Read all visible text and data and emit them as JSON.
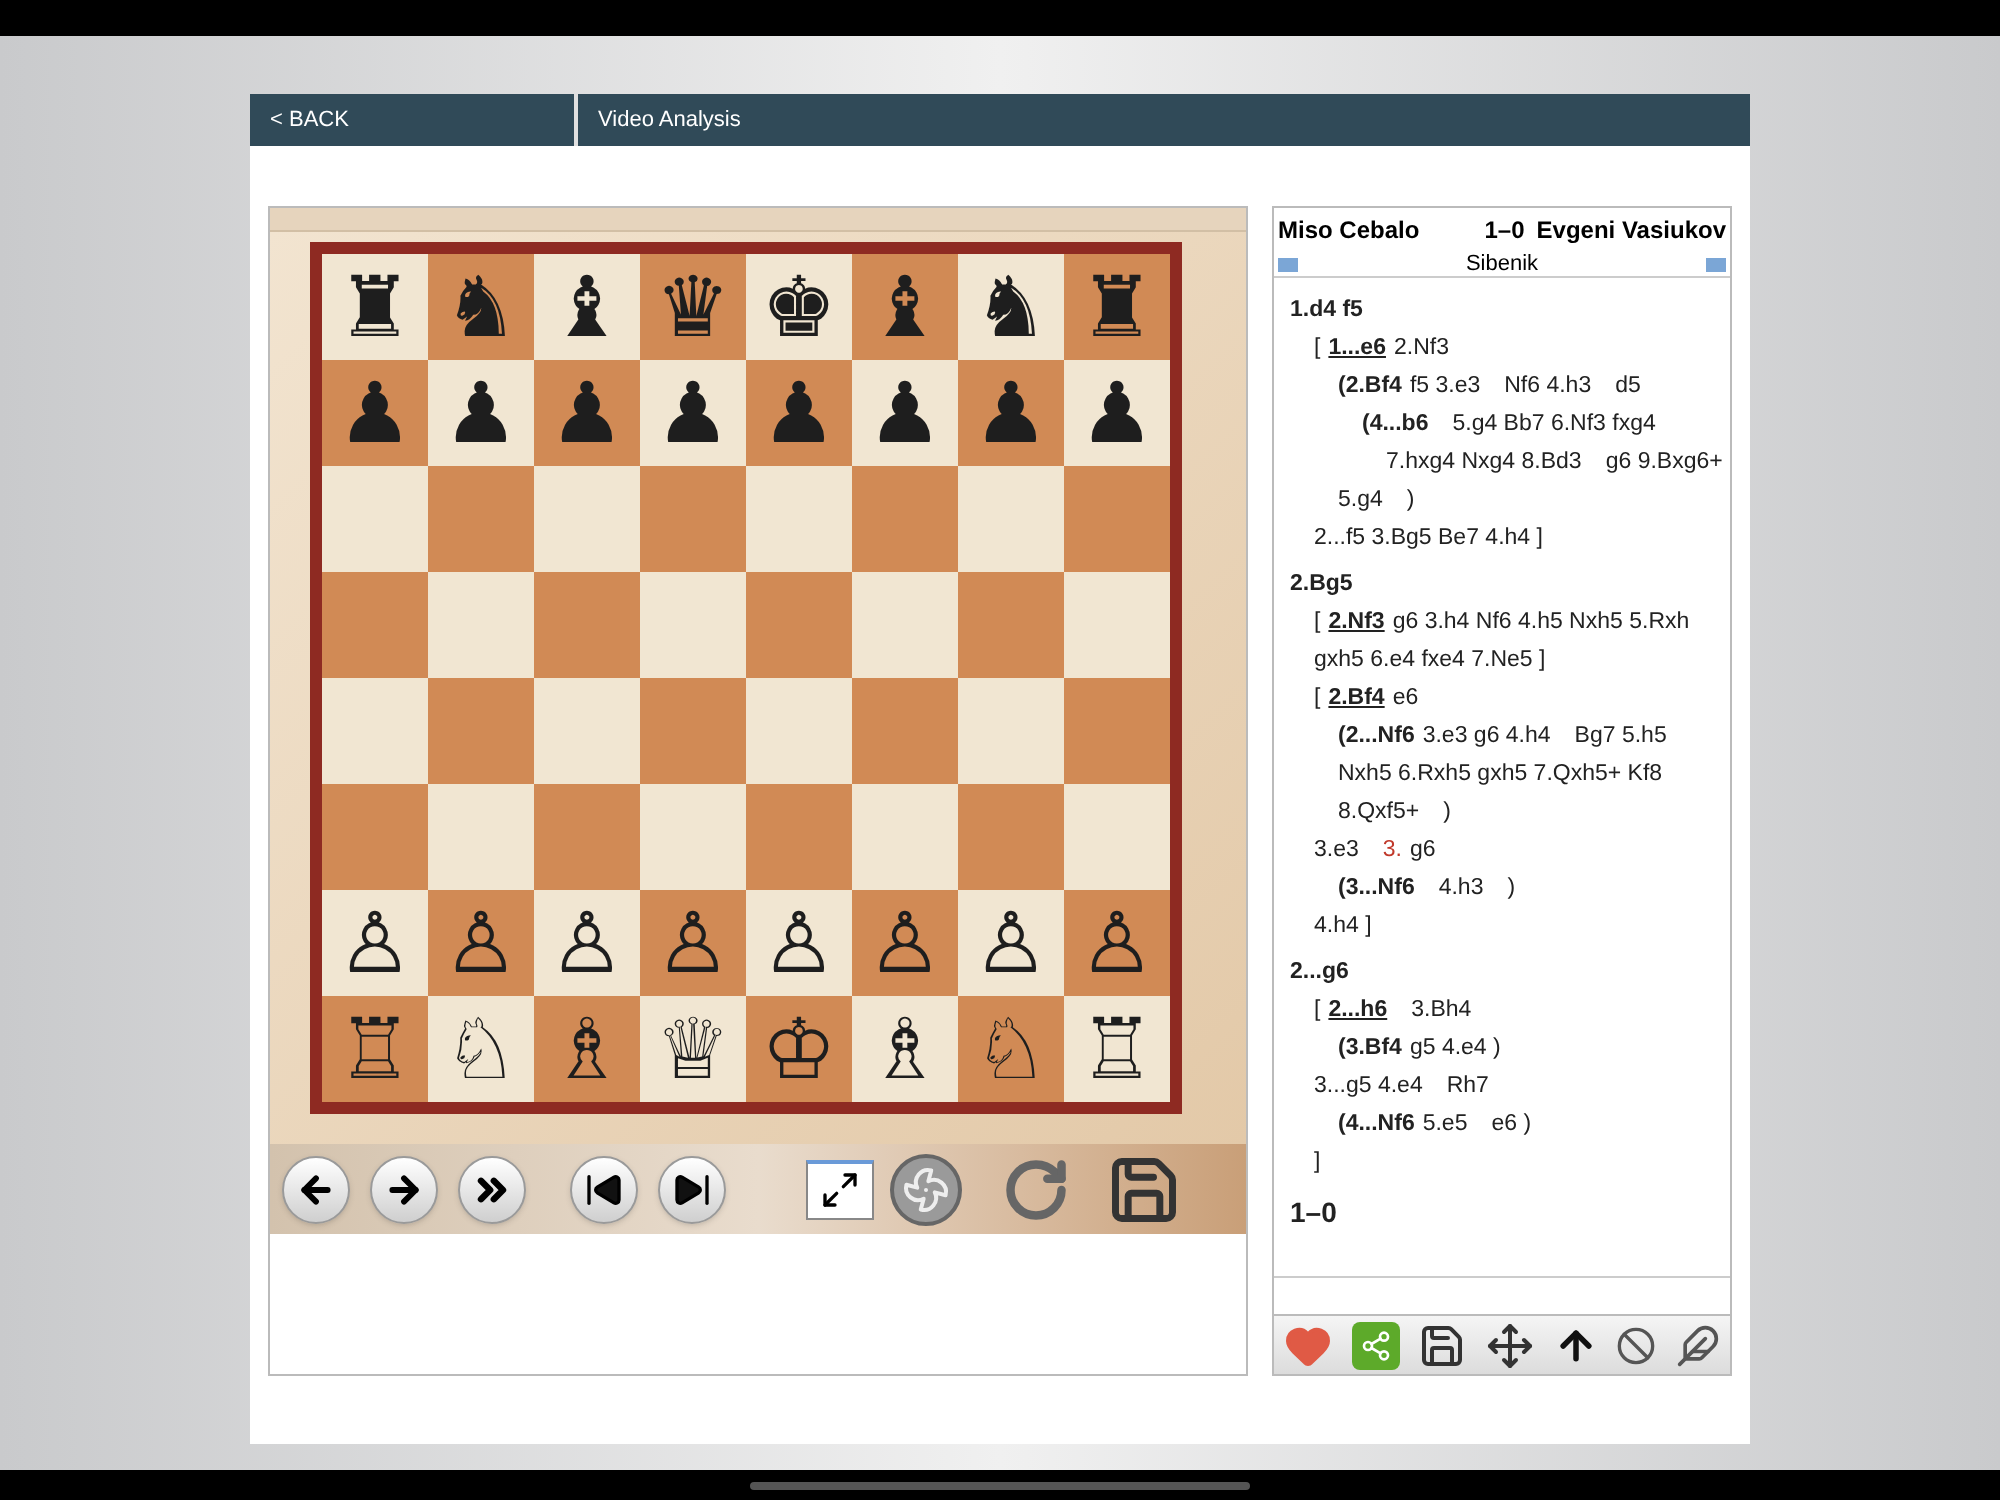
{
  "header": {
    "back": "< BACK",
    "title": "Video Analysis"
  },
  "board": {
    "ranks": [
      {
        "kind": "pieces",
        "squares": [
          "♜",
          "♞",
          "♝",
          "♛",
          "♚",
          "♝",
          "♞",
          "♜"
        ]
      },
      {
        "kind": "pieces",
        "squares": [
          "♟",
          "♟",
          "♟",
          "♟",
          "♟",
          "♟",
          "♟",
          "♟"
        ]
      },
      {
        "kind": "empty"
      },
      {
        "kind": "empty"
      },
      {
        "kind": "empty"
      },
      {
        "kind": "empty"
      },
      {
        "kind": "pieces",
        "squares": [
          "♙",
          "♙",
          "♙",
          "♙",
          "♙",
          "♙",
          "♙",
          "♙"
        ]
      },
      {
        "kind": "pieces",
        "squares": [
          "♖",
          "♘",
          "♗",
          "♕",
          "♔",
          "♗",
          "♘",
          "♖"
        ]
      }
    ]
  },
  "notation": {
    "white_player": "Miso Cebalo",
    "result": "1–0",
    "black_player": "Evgeni Vasiukov",
    "event": "Sibenik",
    "lines": [
      {
        "segments": [
          {
            "text": "1.d4 f5",
            "kind": "bold"
          }
        ],
        "children": [
          {
            "segments": [
              {
                "text": "[",
                "kind": "plain"
              },
              {
                "text": "1...e6",
                "kind": "key"
              },
              {
                "text": "2.Nf3",
                "kind": "plain"
              }
            ],
            "children": [
              {
                "segments": [
                  {
                    "text": "(2.Bf4",
                    "kind": "bold"
                  },
                  {
                    "text": "f5 3.e3",
                    "kind": "plain"
                  },
                  {
                    "text": "Nf6 4.h3",
                    "kind": "gap"
                  },
                  {
                    "text": "d5",
                    "kind": "gap"
                  }
                ],
                "children": [
                  {
                    "segments": [
                      {
                        "text": "(4...b6",
                        "kind": "bold"
                      },
                      {
                        "text": "5.g4 Bb7 6.Nf3 fxg4",
                        "kind": "gap"
                      }
                    ],
                    "children": [
                      {
                        "segments": [
                          {
                            "text": "7.hxg4 Nxg4 8.Bd3",
                            "kind": "plain"
                          },
                          {
                            "text": "g6 9.Bxg6+",
                            "kind": "gap"
                          }
                        ]
                      }
                    ]
                  }
                ]
              },
              {
                "segments": [
                  {
                    "text": "5.g4",
                    "kind": "plain"
                  },
                  {
                    "text": ")",
                    "kind": "gap"
                  }
                ]
              }
            ]
          },
          {
            "segments": [
              {
                "text": "2...f5 3.Bg5 Be7 4.h4 ]",
                "kind": "plain"
              }
            ]
          }
        ]
      },
      {
        "segments": [
          {
            "text": "2.Bg5",
            "kind": "bold"
          }
        ],
        "children": [
          {
            "segments": [
              {
                "text": "[",
                "kind": "plain"
              },
              {
                "text": "2.Nf3",
                "kind": "key"
              },
              {
                "text": "g6 3.h4 Nf6 4.h5 Nxh5 5.Rxh",
                "kind": "plain"
              }
            ]
          },
          {
            "segments": [
              {
                "text": "gxh5 6.e4 fxe4 7.Ne5 ]",
                "kind": "plain"
              }
            ]
          },
          {
            "segments": [
              {
                "text": "[",
                "kind": "plain"
              },
              {
                "text": "2.Bf4",
                "kind": "key"
              },
              {
                "text": "e6",
                "kind": "plain"
              }
            ],
            "children": [
              {
                "segments": [
                  {
                    "text": "(2...Nf6",
                    "kind": "bold"
                  },
                  {
                    "text": "3.e3 g6 4.h4",
                    "kind": "plain"
                  },
                  {
                    "text": "Bg7 5.h5",
                    "kind": "gap"
                  }
                ]
              },
              {
                "segments": [
                  {
                    "text": "Nxh5 6.Rxh5 gxh5 7.Qxh5+ Kf8",
                    "kind": "plain"
                  }
                ]
              },
              {
                "segments": [
                  {
                    "text": "8.Qxf5+",
                    "kind": "plain"
                  },
                  {
                    "text": ")",
                    "kind": "gap"
                  }
                ]
              }
            ]
          },
          {
            "segments": [
              {
                "text": "3.e3",
                "kind": "plain"
              },
              {
                "text": "3.",
                "kind": "red"
              },
              {
                "text": "g6",
                "kind": "plain"
              }
            ],
            "children": [
              {
                "segments": [
                  {
                    "text": "(3...Nf6",
                    "kind": "bold"
                  },
                  {
                    "text": "4.h3",
                    "kind": "gap"
                  },
                  {
                    "text": ")",
                    "kind": "gap"
                  }
                ]
              }
            ]
          },
          {
            "segments": [
              {
                "text": "4.h4 ]",
                "kind": "plain"
              }
            ]
          }
        ]
      },
      {
        "segments": [
          {
            "text": "2...g6",
            "kind": "bold"
          }
        ],
        "children": [
          {
            "segments": [
              {
                "text": "[",
                "kind": "plain"
              },
              {
                "text": "2...h6",
                "kind": "key"
              },
              {
                "text": "3.Bh4",
                "kind": "gap"
              }
            ],
            "children": [
              {
                "segments": [
                  {
                    "text": "(3.Bf4",
                    "kind": "bold"
                  },
                  {
                    "text": "g5 4.e4 )",
                    "kind": "plain"
                  }
                ]
              }
            ]
          },
          {
            "segments": [
              {
                "text": "3...g5 4.e4",
                "kind": "plain"
              },
              {
                "text": "Rh7",
                "kind": "gap"
              }
            ],
            "children": [
              {
                "segments": [
                  {
                    "text": "(4...Nf6",
                    "kind": "bold"
                  },
                  {
                    "text": "5.e5",
                    "kind": "plain"
                  },
                  {
                    "text": "e6 )",
                    "kind": "gap"
                  }
                ]
              }
            ]
          },
          {
            "segments": [
              {
                "text": "]",
                "kind": "plain"
              }
            ]
          }
        ]
      },
      {
        "segments": [
          {
            "text": "1–0",
            "kind": "result"
          }
        ]
      }
    ]
  }
}
